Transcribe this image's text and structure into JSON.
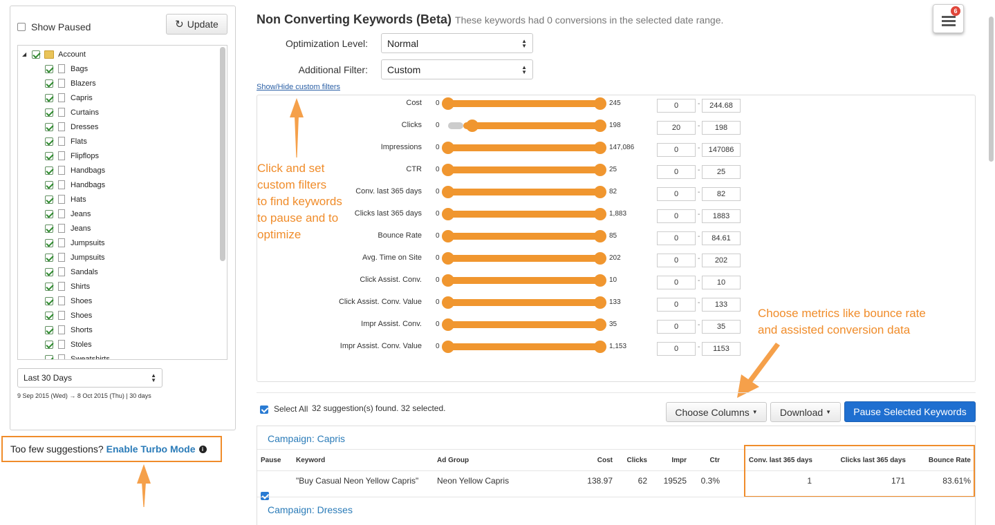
{
  "sidebar": {
    "show_paused_label": "Show Paused",
    "update_label": "Update",
    "tree": {
      "root": "Account",
      "items": [
        "Bags",
        "Blazers",
        "Capris",
        "Curtains",
        "Dresses",
        "Flats",
        "Flipflops",
        "Handbags",
        "Handbags",
        "Hats",
        "Jeans",
        "Jeans",
        "Jumpsuits",
        "Jumpsuits",
        "Sandals",
        "Shirts",
        "Shoes",
        "Shoes",
        "Shorts",
        "Stoles",
        "Sweatshirts"
      ]
    },
    "date_range_select": "Last 30 Days",
    "date_range_text": "9 Sep 2015 (Wed) → 8 Oct 2015 (Thu) | 30 days",
    "turbo_prefix": "Too few suggestions?",
    "turbo_link": "Enable Turbo Mode"
  },
  "header": {
    "title": "Non Converting Keywords (Beta)",
    "subtitle": "These keywords had 0 conversions in the selected date range.",
    "badge_count": "6"
  },
  "options": {
    "optimization_label": "Optimization Level:",
    "optimization_value": "Normal",
    "filter_label": "Additional Filter:",
    "filter_value": "Custom",
    "toggle_link": "Show/Hide custom filters"
  },
  "filters": [
    {
      "label": "Cost",
      "min_text": "0",
      "max_text": "245",
      "low": "0",
      "high": "244.68",
      "low_frac": 0,
      "high_frac": 1
    },
    {
      "label": "Clicks",
      "min_text": "0",
      "max_text": "198",
      "low": "20",
      "high": "198",
      "low_frac": 0.1,
      "high_frac": 1
    },
    {
      "label": "Impressions",
      "min_text": "0",
      "max_text": "147,086",
      "low": "0",
      "high": "147086",
      "low_frac": 0,
      "high_frac": 1
    },
    {
      "label": "CTR",
      "min_text": "0",
      "max_text": "25",
      "low": "0",
      "high": "25",
      "low_frac": 0,
      "high_frac": 1
    },
    {
      "label": "Conv. last 365 days",
      "min_text": "0",
      "max_text": "82",
      "low": "0",
      "high": "82",
      "low_frac": 0,
      "high_frac": 1
    },
    {
      "label": "Clicks last 365 days",
      "min_text": "0",
      "max_text": "1,883",
      "low": "0",
      "high": "1883",
      "low_frac": 0,
      "high_frac": 1
    },
    {
      "label": "Bounce Rate",
      "min_text": "0",
      "max_text": "85",
      "low": "0",
      "high": "84.61",
      "low_frac": 0,
      "high_frac": 1
    },
    {
      "label": "Avg. Time on Site",
      "min_text": "0",
      "max_text": "202",
      "low": "0",
      "high": "202",
      "low_frac": 0,
      "high_frac": 1
    },
    {
      "label": "Click Assist. Conv.",
      "min_text": "0",
      "max_text": "10",
      "low": "0",
      "high": "10",
      "low_frac": 0,
      "high_frac": 1
    },
    {
      "label": "Click Assist. Conv. Value",
      "min_text": "0",
      "max_text": "133",
      "low": "0",
      "high": "133",
      "low_frac": 0,
      "high_frac": 1
    },
    {
      "label": "Impr Assist. Conv.",
      "min_text": "0",
      "max_text": "35",
      "low": "0",
      "high": "35",
      "low_frac": 0,
      "high_frac": 1
    },
    {
      "label": "Impr Assist. Conv. Value",
      "min_text": "0",
      "max_text": "1,153",
      "low": "0",
      "high": "1153",
      "low_frac": 0,
      "high_frac": 1
    }
  ],
  "annotations": {
    "filters_note": [
      "Click and set",
      "custom filters",
      "to find keywords",
      "to pause and to",
      "optimize"
    ],
    "metrics_note": [
      "Choose metrics like bounce rate",
      "and assisted conversion data"
    ]
  },
  "actions": {
    "select_all_label": "Select All",
    "summary": "32 suggestion(s) found. 32 selected.",
    "choose_columns": "Choose Columns",
    "download": "Download",
    "pause_selected": "Pause Selected Keywords"
  },
  "results": {
    "campaign_1": "Campaign: Capris",
    "campaign_2": "Campaign: Dresses",
    "columns": {
      "pause": "Pause",
      "keyword": "Keyword",
      "ad_group": "Ad Group",
      "cost": "Cost",
      "clicks": "Clicks",
      "impr": "Impr",
      "ctr": "Ctr",
      "conv365": "Conv. last 365 days",
      "clicks365": "Clicks last 365 days",
      "bounce": "Bounce Rate"
    },
    "row": {
      "keyword": "\"Buy Casual Neon Yellow Capris\"",
      "ad_group": "Neon Yellow Capris",
      "cost": "138.97",
      "clicks": "62",
      "impr": "19525",
      "ctr": "0.3%",
      "conv365": "1",
      "clicks365": "171",
      "bounce": "83.61%"
    }
  },
  "colors": {
    "accent": "#f08c2a",
    "primary": "#1f6fd0",
    "link": "#2a7bb8"
  }
}
